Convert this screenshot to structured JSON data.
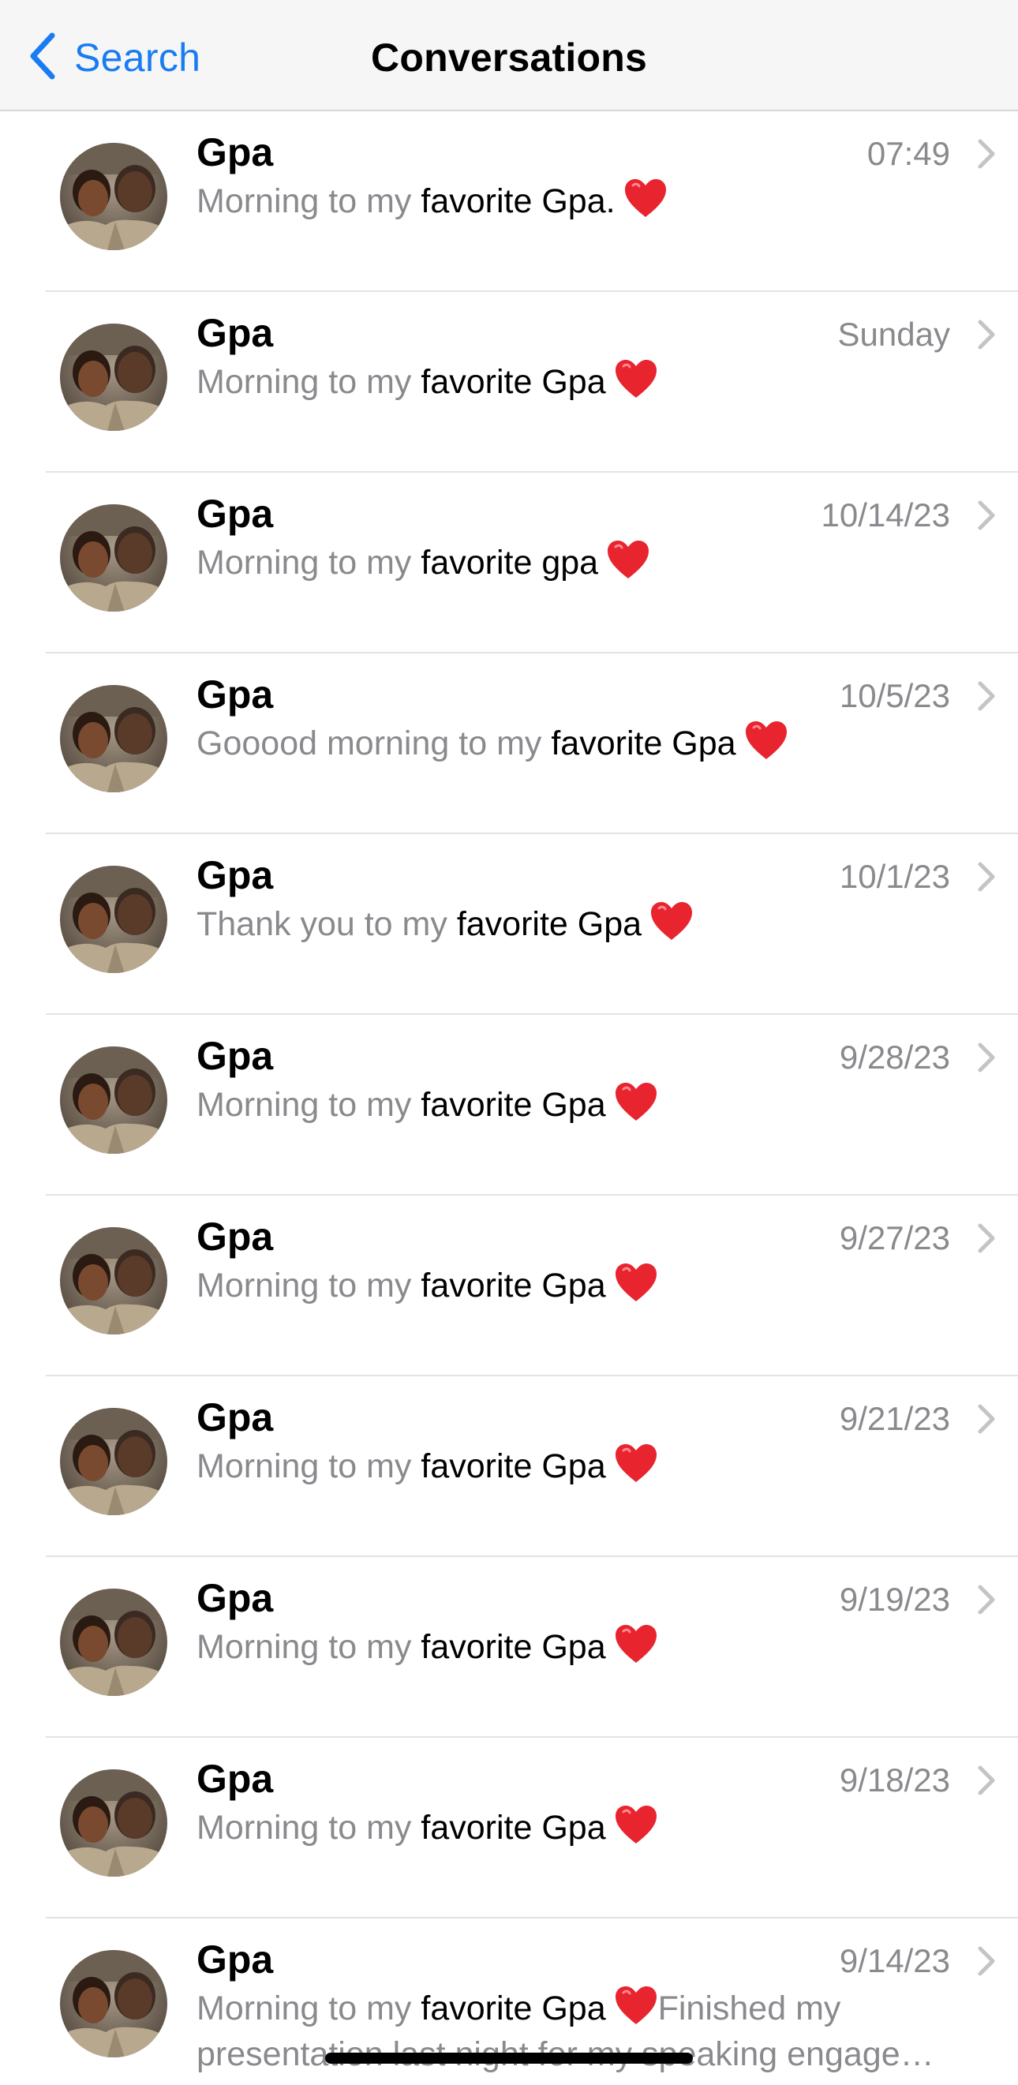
{
  "nav": {
    "back_label": "Search",
    "title": "Conversations"
  },
  "conversations": [
    {
      "name": "Gpa",
      "date": "07:49",
      "pre": "Morning to my ",
      "highlight": "favorite Gpa.",
      "post": "",
      "emoji": "heart-icon"
    },
    {
      "name": "Gpa",
      "date": "Sunday",
      "pre": "Morning to my ",
      "highlight": "favorite Gpa",
      "post": "",
      "emoji": "heart-icon"
    },
    {
      "name": "Gpa",
      "date": "10/14/23",
      "pre": "Morning to my ",
      "highlight": "favorite gpa",
      "post": "",
      "emoji": "heart-icon"
    },
    {
      "name": "Gpa",
      "date": "10/5/23",
      "pre": "Gooood morning to my ",
      "highlight": "favorite Gpa",
      "post": "",
      "emoji": "heart-icon"
    },
    {
      "name": "Gpa",
      "date": "10/1/23",
      "pre": "Thank you to my ",
      "highlight": "favorite Gpa",
      "post": "",
      "emoji": "heart-icon"
    },
    {
      "name": "Gpa",
      "date": "9/28/23",
      "pre": "Morning to my ",
      "highlight": "favorite Gpa",
      "post": "",
      "emoji": "heart-icon"
    },
    {
      "name": "Gpa",
      "date": "9/27/23",
      "pre": "Morning to my ",
      "highlight": "favorite Gpa",
      "post": "",
      "emoji": "heart-icon"
    },
    {
      "name": "Gpa",
      "date": "9/21/23",
      "pre": "Morning to my ",
      "highlight": "favorite Gpa",
      "post": "",
      "emoji": "heart-icon"
    },
    {
      "name": "Gpa",
      "date": "9/19/23",
      "pre": "Morning to my ",
      "highlight": "favorite Gpa",
      "post": "",
      "emoji": "heart-icon"
    },
    {
      "name": "Gpa",
      "date": "9/18/23",
      "pre": "Morning to my ",
      "highlight": "favorite Gpa",
      "post": "",
      "emoji": "heart-icon"
    },
    {
      "name": "Gpa",
      "date": "9/14/23",
      "pre": "Morning to my ",
      "highlight": "favorite Gpa",
      "post": "Finished my",
      "line2": "presentation last night for my speaking engage…",
      "emoji": "heart-icon"
    }
  ],
  "colors": {
    "accent": "#1a7cf2",
    "secondary_text": "#8a8a8e",
    "heart": "#e8242f",
    "nav_background": "#f6f6f6"
  }
}
